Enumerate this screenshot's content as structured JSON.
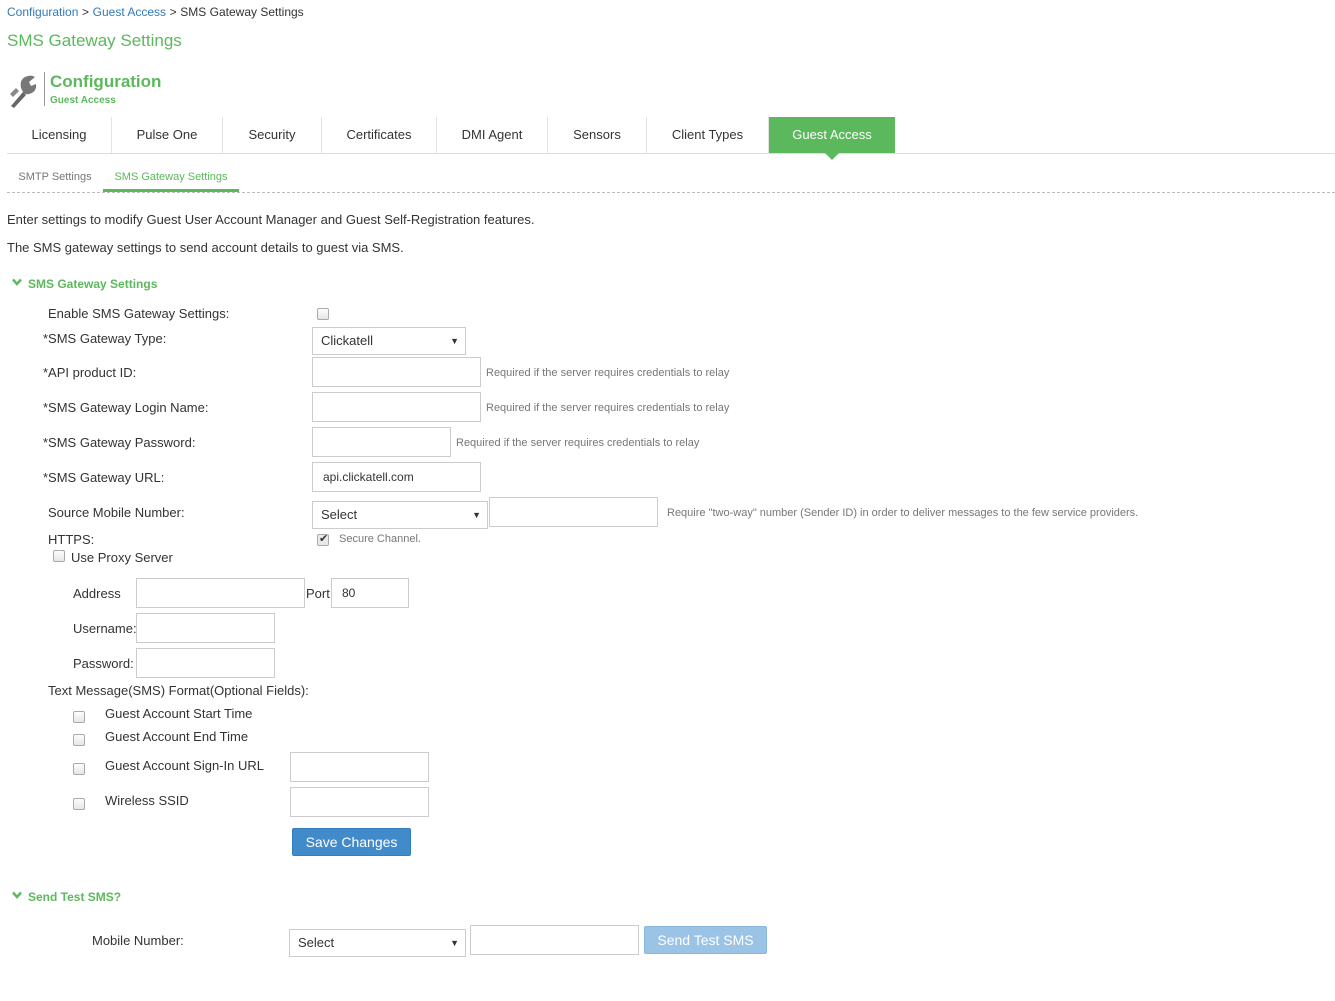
{
  "breadcrumb": {
    "items": [
      "Configuration",
      "Guest Access"
    ],
    "separator": ">",
    "current": "SMS Gateway Settings"
  },
  "page_title": "SMS Gateway Settings",
  "header": {
    "title": "Configuration",
    "subtitle": "Guest Access",
    "icon": "wrench-icon"
  },
  "tabs": [
    {
      "label": "Licensing"
    },
    {
      "label": "Pulse One"
    },
    {
      "label": "Security"
    },
    {
      "label": "Certificates"
    },
    {
      "label": "DMI Agent"
    },
    {
      "label": "Sensors"
    },
    {
      "label": "Client Types"
    },
    {
      "label": "Guest Access",
      "active": true
    }
  ],
  "subtabs": [
    {
      "label": "SMTP Settings"
    },
    {
      "label": "SMS Gateway Settings",
      "active": true
    }
  ],
  "intro": {
    "line1": "Enter settings to modify Guest User Account Manager and Guest Self-Registration features.",
    "line2": "The SMS gateway settings to send account details to guest via SMS."
  },
  "sms_section": {
    "title": "SMS Gateway Settings",
    "enable_label": "Enable SMS Gateway Settings:",
    "enable_checked": false,
    "type_label": "*SMS Gateway Type:",
    "type_value": "Clickatell",
    "api_label": "*API product ID:",
    "api_value": "",
    "api_hint": "Required if the server requires credentials to relay",
    "login_label": "*SMS Gateway Login Name:",
    "login_value": "",
    "login_hint": "Required if the server requires credentials to relay",
    "password_label": "*SMS Gateway Password:",
    "password_value": "",
    "password_hint": "Required if the server requires credentials to relay",
    "url_label": "*SMS Gateway URL:",
    "url_value": "api.clickatell.com",
    "source_label": "Source Mobile Number:",
    "source_select": "Select",
    "source_value": "",
    "source_hint": "Require \"two-way\" number (Sender ID) in order to deliver messages to the few service providers.",
    "https_label": "HTTPS:",
    "https_checked": true,
    "https_hint": "Secure Channel.",
    "proxy_label": "Use Proxy Server",
    "proxy_checked": false,
    "address_label": "Address",
    "address_value": "",
    "port_label": "Port",
    "port_value": "80",
    "username_label": "Username:",
    "username_value": "",
    "proxy_password_label": "Password:",
    "proxy_password_value": "",
    "format_label": "Text Message(SMS) Format(Optional Fields):",
    "format_fields": [
      {
        "label": "Guest Account Start Time",
        "checked": false
      },
      {
        "label": "Guest Account End Time",
        "checked": false
      },
      {
        "label": "Guest Account Sign-In URL",
        "checked": false,
        "value": ""
      },
      {
        "label": "Wireless SSID",
        "checked": false,
        "value": ""
      }
    ],
    "save_button": "Save Changes"
  },
  "test_section": {
    "title": "Send Test SMS?",
    "mobile_label": "Mobile Number:",
    "mobile_select": "Select",
    "mobile_value": "",
    "send_button": "Send Test SMS"
  },
  "colors": {
    "accent": "#5cb85c",
    "link": "#337ab7",
    "primary_button": "#428bca",
    "disabled_button": "#9bc3e6"
  }
}
